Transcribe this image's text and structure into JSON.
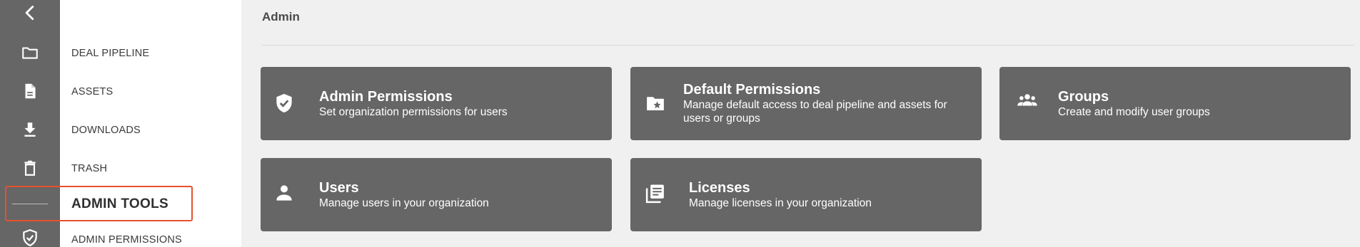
{
  "rail": {
    "icons": [
      "back-chevron-icon",
      "folder-icon",
      "document-icon",
      "download-icon",
      "trash-icon",
      "admin-shield-icon"
    ]
  },
  "nav": {
    "items": [
      {
        "label": "DEAL PIPELINE"
      },
      {
        "label": "ASSETS"
      },
      {
        "label": "DOWNLOADS"
      },
      {
        "label": "TRASH"
      }
    ],
    "section_label": "ADMIN TOOLS",
    "sub_items": [
      {
        "label": "ADMIN PERMISSIONS"
      }
    ]
  },
  "main": {
    "title": "Admin",
    "cards": [
      {
        "title": "Admin Permissions",
        "description": "Set organization permissions for users",
        "icon": "shield-check-icon"
      },
      {
        "title": "Default Permissions",
        "description": "Manage default access to deal pipeline and assets for users or groups",
        "icon": "folder-star-icon"
      },
      {
        "title": "Groups",
        "description": "Create and modify user groups",
        "icon": "groups-icon"
      },
      {
        "title": "Users",
        "description": "Manage users in your organization",
        "icon": "person-icon"
      },
      {
        "title": "Licenses",
        "description": "Manage licenses in your organization",
        "icon": "library-books-icon"
      }
    ]
  },
  "colors": {
    "rail_bg": "#666666",
    "card_bg": "#666666",
    "highlight": "#e5512d",
    "page_bg": "#f0f0f0"
  }
}
